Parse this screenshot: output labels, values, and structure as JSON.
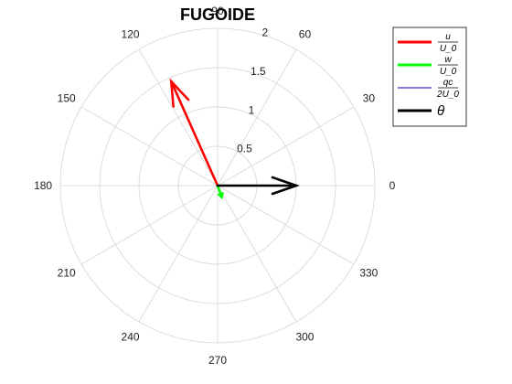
{
  "chart_data": {
    "type": "polar-compass",
    "title": "FUGOIDE",
    "r_ticks": [
      0.5,
      1,
      1.5,
      2
    ],
    "r_tick_labels": [
      "0.5",
      "1",
      "1.5",
      "2"
    ],
    "r_lim": [
      0,
      2
    ],
    "theta_ticks_deg": [
      0,
      30,
      60,
      90,
      120,
      150,
      180,
      210,
      240,
      270,
      300,
      330
    ],
    "theta_tick_labels": [
      "0",
      "30",
      "60",
      "90",
      "120",
      "150",
      "180",
      "210",
      "240",
      "270",
      "300",
      "330"
    ],
    "grid": true,
    "grid_color": "#dcdcdc",
    "legend_position": "top-right",
    "series": [
      {
        "legend": "u/U0",
        "num": "u",
        "den": "U_0",
        "color": "#ff0000",
        "magnitude": 1.45,
        "angle_deg": 114,
        "width": 2.6,
        "head": true
      },
      {
        "legend": "w/U0",
        "num": "w",
        "den": "U_0",
        "color": "#00ff00",
        "magnitude": 0.16,
        "angle_deg": 290,
        "width": 2.6,
        "head": false
      },
      {
        "legend": "qc/2U0",
        "num": "qc",
        "den": "2U_0",
        "color": "#0000aa",
        "magnitude": 0.0,
        "angle_deg": 0,
        "width": 1,
        "head": false
      },
      {
        "legend": "theta",
        "num": "θ",
        "den": "",
        "color": "#000000",
        "magnitude": 1.0,
        "angle_deg": 0,
        "width": 2.6,
        "head": true
      }
    ]
  }
}
